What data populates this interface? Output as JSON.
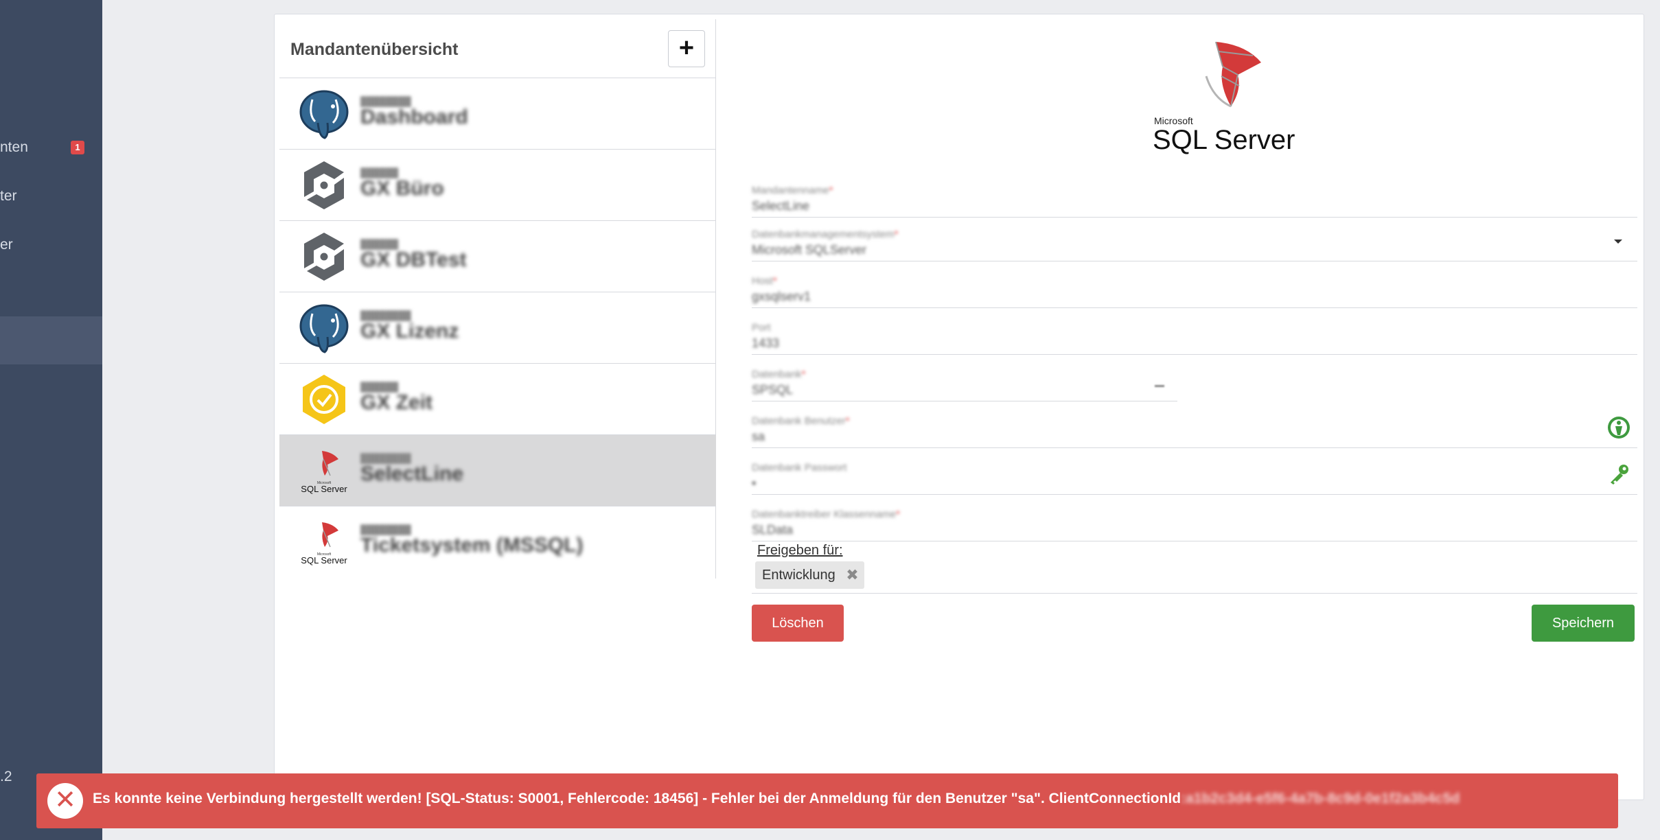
{
  "sidebar": {
    "items": [
      {
        "label": "nten",
        "badge": "1"
      },
      {
        "label": "ter"
      },
      {
        "label": "er"
      }
    ],
    "version_fragment": ".2"
  },
  "list": {
    "title": "Mandantenübersicht",
    "add_label": "+",
    "rows": [
      {
        "icon": "postgresql-elephant-icon",
        "sub": "████████",
        "name": "Dashboard"
      },
      {
        "icon": "gx-logo-icon",
        "sub": "██████",
        "name": "GX Büro"
      },
      {
        "icon": "gx-logo-icon",
        "sub": "██████",
        "name": "GX DBTest"
      },
      {
        "icon": "postgresql-elephant-icon",
        "sub": "████████",
        "name": "GX Lizenz"
      },
      {
        "icon": "clock-hexagon-icon",
        "sub": "██████",
        "name": "GX Zeit"
      },
      {
        "icon": "sql-server-icon",
        "sub": "████████",
        "name": "SelectLine"
      },
      {
        "icon": "sql-server-icon",
        "sub": "████████",
        "name": "Ticketsystem (MSSQL)"
      }
    ]
  },
  "form": {
    "logo_brand_small": "Microsoft",
    "logo_brand": "SQL Server",
    "fields": [
      {
        "label": "Mandantenname",
        "value": "SelectLine",
        "required": true
      },
      {
        "label": "Datenbankmanagementsystem",
        "value": "Microsoft SQLServer",
        "required": true,
        "select": true
      },
      {
        "label": "Host",
        "value": "gxsqlserv1",
        "required": true
      },
      {
        "label": "Port",
        "value": "1433",
        "required": false
      },
      {
        "label": "Datenbank",
        "value": "SPSQL",
        "required": true,
        "dash": true
      },
      {
        "label": "Datenbank Benutzer",
        "value": "sa",
        "required": true,
        "icon": "user-info-icon"
      },
      {
        "label": "Datenbank Passwort",
        "value": "•",
        "required": false,
        "icon": "key-icon"
      },
      {
        "label": "Datenbanktreiber Klassenname",
        "value": "SLData",
        "required": true
      }
    ],
    "share_label": "Freigeben für:",
    "tag": "Entwicklung",
    "tag_remove": "✖",
    "delete_label": "Löschen",
    "save_label": "Speichern"
  },
  "toast": {
    "icon": "close-circle-icon",
    "message": "Es konnte keine Verbindung hergestellt werden! [SQL-Status: S0001, Fehlercode: 18456] - Fehler bei der Anmeldung für den Benutzer \"sa\". ClientConnectionId",
    "redacted": ":a1b2c3d4-e5f6-4a7b-8c9d-0e1f2a3b4c5d"
  },
  "colors": {
    "sidebar_bg": "#3d4a61",
    "danger": "#d9534f",
    "success": "#3e9a3f",
    "badge": "#e04a4a",
    "selected_row": "#d9d9da"
  }
}
